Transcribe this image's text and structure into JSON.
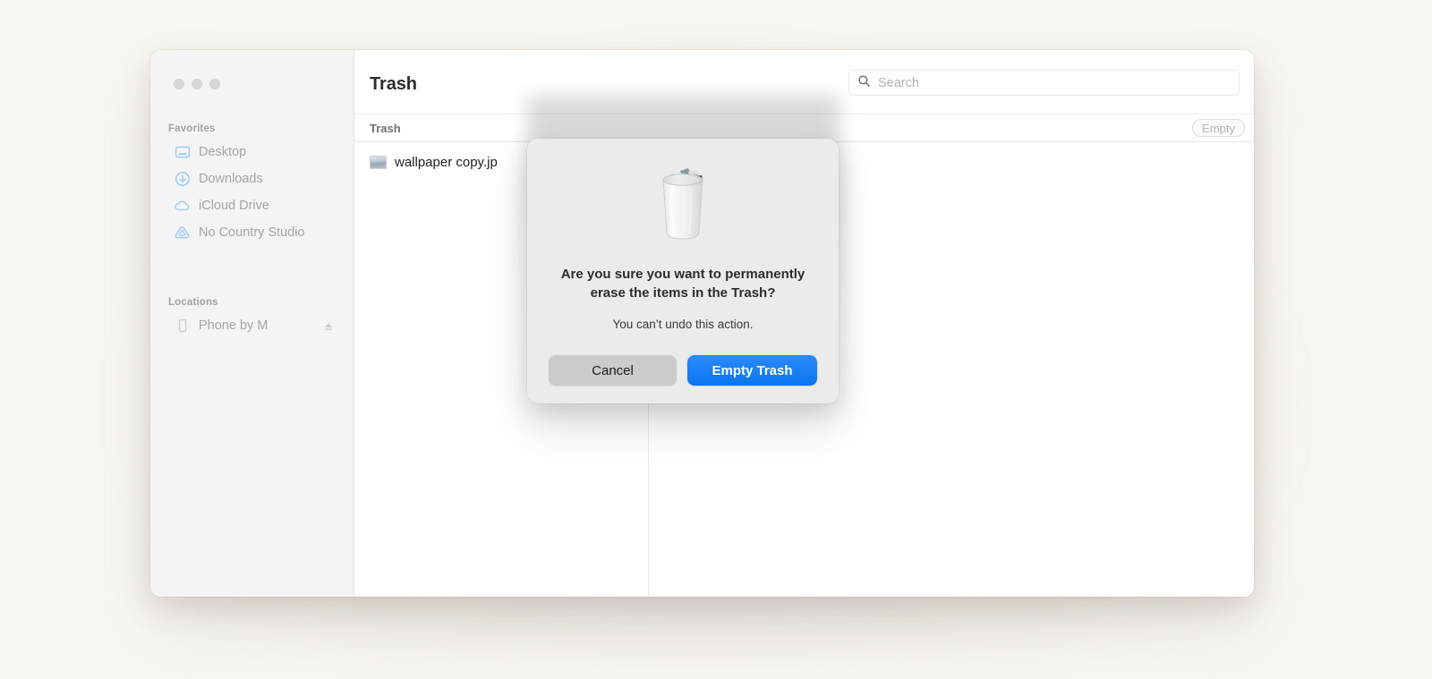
{
  "window": {
    "title": "Trash",
    "traffic_lights": [
      "close-button",
      "minimize-button",
      "zoom-button"
    ]
  },
  "search": {
    "placeholder": "Search",
    "value": "",
    "icon": "search-icon"
  },
  "sidebar": {
    "sections": [
      {
        "title": "Favorites",
        "items": [
          {
            "label": "Desktop",
            "icon": "desktop-icon"
          },
          {
            "label": "Downloads",
            "icon": "downloads-icon"
          },
          {
            "label": "iCloud Drive",
            "icon": "icloud-icon"
          },
          {
            "label": "No Country Studio",
            "icon": "triangle-folder-icon"
          }
        ]
      },
      {
        "title": "Locations",
        "items": [
          {
            "label": "Phone by M",
            "icon": "phone-icon",
            "accessory": "eject-icon"
          }
        ]
      }
    ]
  },
  "column_header": {
    "label": "Trash",
    "empty_button": "Empty"
  },
  "files": [
    {
      "name": "wallpaper copy.jp",
      "icon": "image-thumbnail-icon"
    }
  ],
  "dialog": {
    "icon": "trash-full-icon",
    "heading": "Are you sure you want to permanently erase the items in the Trash?",
    "subtext": "You can’t undo this action.",
    "cancel_label": "Cancel",
    "confirm_label": "Empty Trash"
  },
  "colors": {
    "desktop_background": "#faf7f3",
    "sidebar_background": "#f4f4f4",
    "window_background": "#ffffff",
    "sheet_background": "#ebebeb",
    "accent_blue": "#0a74f0",
    "sidebar_icon_blue": "#a8d0f5",
    "muted_text": "#a5a5a5"
  }
}
